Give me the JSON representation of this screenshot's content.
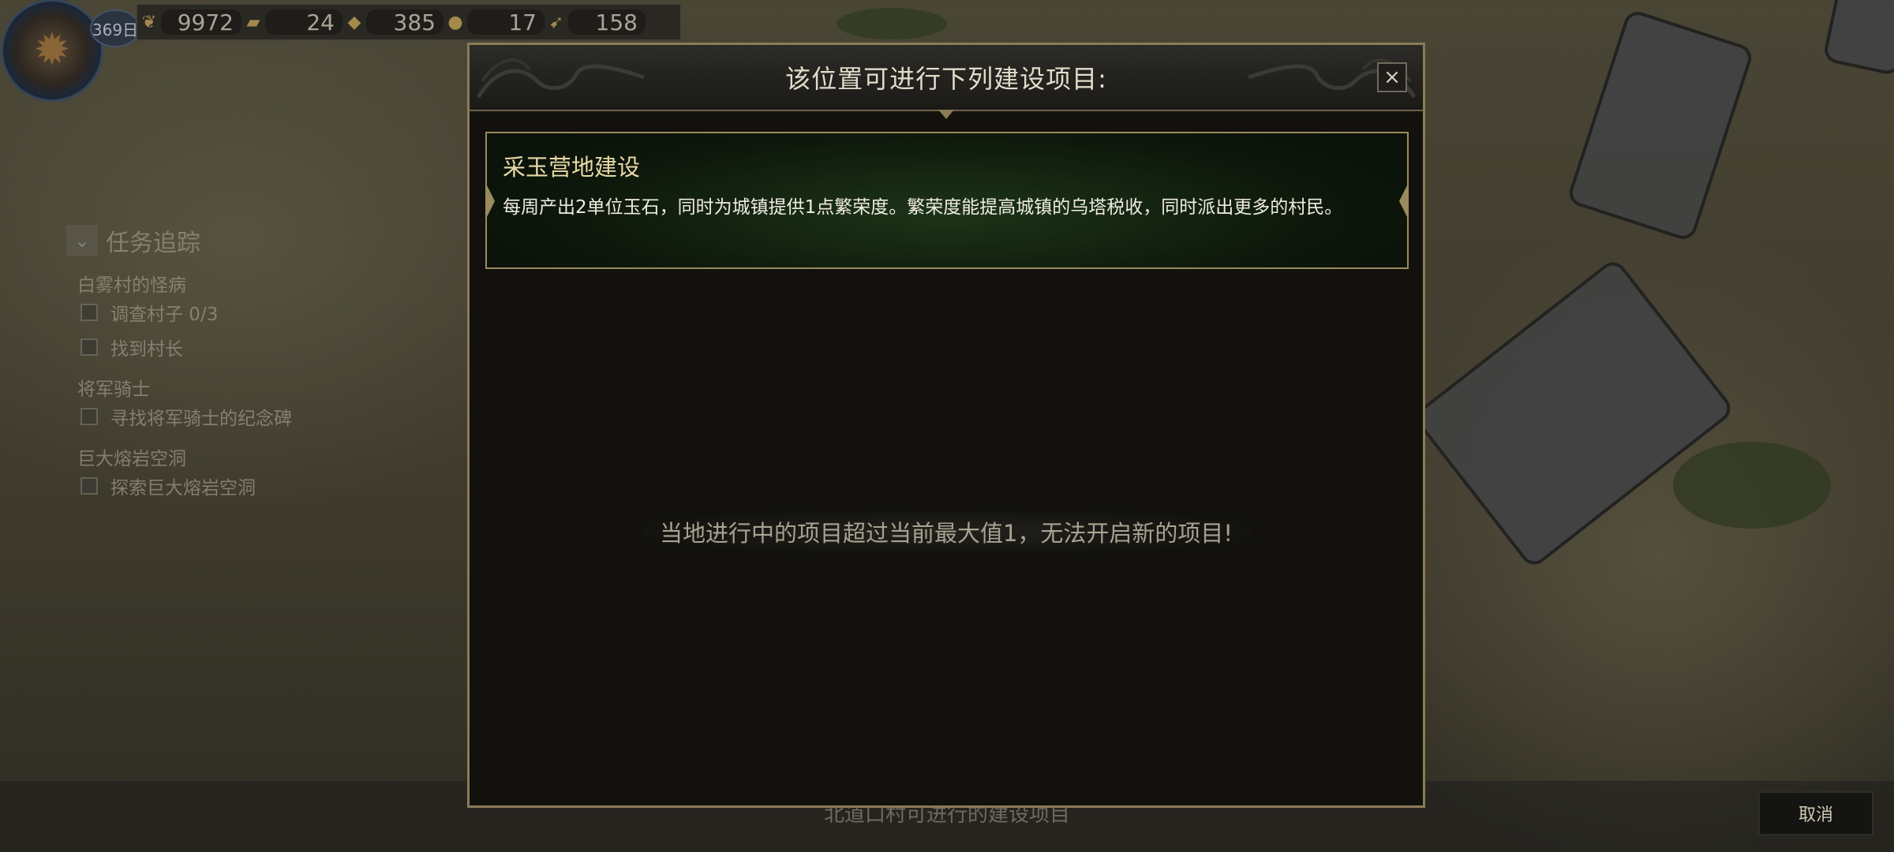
{
  "hud": {
    "day": "369日",
    "resources": [
      {
        "icon": "leaf-coin-icon",
        "value": "9972"
      },
      {
        "icon": "gold-bar-icon",
        "value": "24"
      },
      {
        "icon": "stone-pile-icon",
        "value": "385"
      },
      {
        "icon": "oil-drop-icon",
        "value": "17"
      },
      {
        "icon": "horn-icon",
        "value": "158"
      }
    ]
  },
  "quests": {
    "title": "任务追踪",
    "groups": [
      {
        "name": "白雾村的怪病",
        "tasks": [
          "调查村子  0/3",
          "找到村长"
        ]
      },
      {
        "name": "将军骑士",
        "tasks": [
          "寻找将军骑士的纪念碑"
        ]
      },
      {
        "name": "巨大熔岩空洞",
        "tasks": [
          "探索巨大熔岩空洞"
        ]
      }
    ]
  },
  "dialog": {
    "title": "该位置可进行下列建设项目:",
    "close_symbol": "×",
    "project": {
      "name": "采玉营地建设",
      "description": "每周产出2单位玉石，同时为城镇提供1点繁荣度。繁荣度能提高城镇的乌塔税收，同时派出更多的村民。"
    },
    "limit_message": "当地进行中的项目超过当前最大值1，无法开启新的项目!"
  },
  "footer": {
    "hint": "北道口村可进行的建设项目",
    "cancel_label": "取消"
  }
}
